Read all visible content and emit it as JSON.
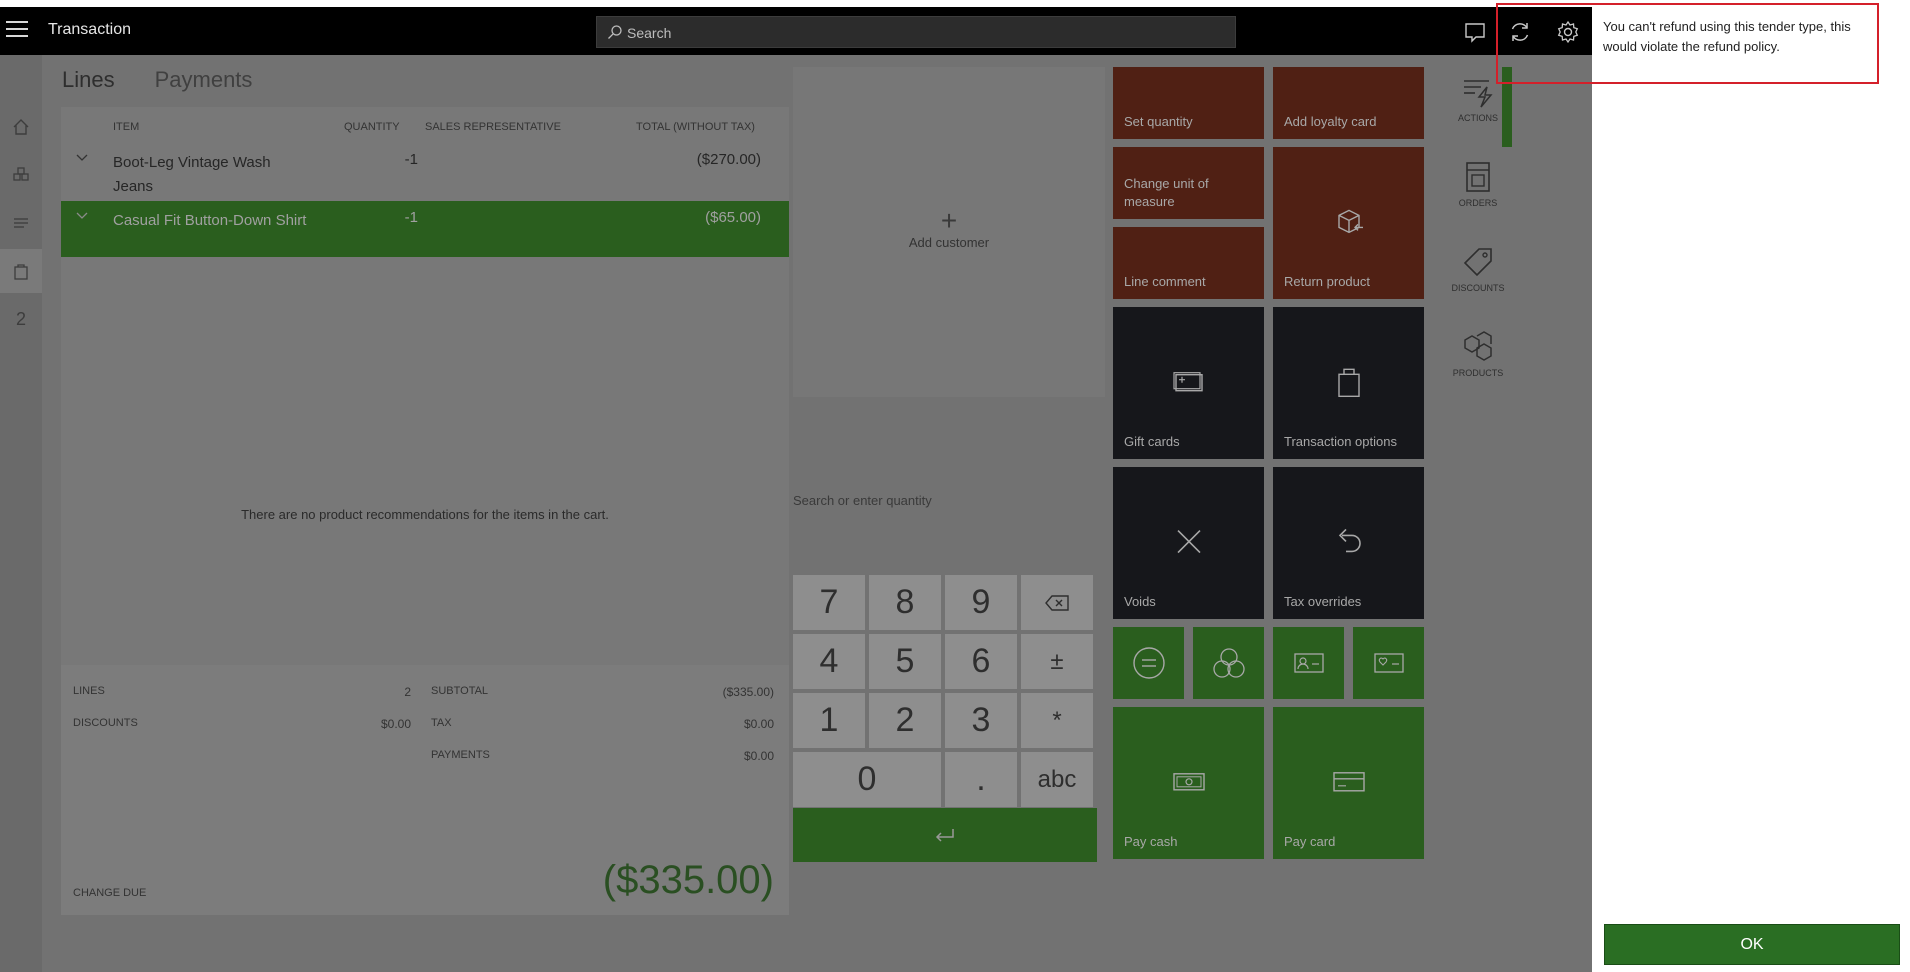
{
  "topbar": {
    "title": "Transaction",
    "search_placeholder": "Search"
  },
  "leftnav": {
    "items": [
      {
        "icon": "home-icon"
      },
      {
        "icon": "products-icon"
      },
      {
        "icon": "list-icon"
      },
      {
        "icon": "bag-icon"
      },
      {
        "label": "2"
      }
    ]
  },
  "tabs": {
    "lines": "Lines",
    "payments": "Payments"
  },
  "lines": {
    "columns": [
      "ITEM",
      "QUANTITY",
      "SALES REPRESENTATIVE",
      "TOTAL (WITHOUT TAX)"
    ],
    "rows": [
      {
        "item": "Boot-Leg Vintage Wash Jeans",
        "quantity": "-1",
        "rep": "",
        "total": "($270.00)"
      },
      {
        "item": "Casual Fit Button-Down Shirt",
        "quantity": "-1",
        "rep": "",
        "total": "($65.00)"
      }
    ],
    "no_recommendations": "There are no product recommendations for the items in the cart."
  },
  "totals": {
    "lines_label": "LINES",
    "lines_value": "2",
    "discounts_label": "DISCOUNTS",
    "discounts_value": "$0.00",
    "subtotal_label": "SUBTOTAL",
    "subtotal_value": "($335.00)",
    "tax_label": "TAX",
    "tax_value": "$0.00",
    "payments_label": "PAYMENTS",
    "payments_value": "$0.00",
    "change_due_label": "CHANGE DUE",
    "change_due_value": "($335.00)"
  },
  "customer": {
    "add_label": "Add customer"
  },
  "numpad": {
    "search_placeholder": "Search or enter quantity",
    "keys": [
      "7",
      "8",
      "9",
      "4",
      "5",
      "6",
      "±",
      "1",
      "2",
      "3",
      "*",
      "0",
      ".",
      "abc"
    ]
  },
  "tiles": {
    "set_quantity": "Set quantity",
    "add_loyalty_card": "Add loyalty card",
    "change_unit_of_measure": "Change unit of measure",
    "return_product": "Return product",
    "line_comment": "Line comment",
    "gift_cards": "Gift cards",
    "transaction_options": "Transaction options",
    "voids": "Voids",
    "tax_overrides": "Tax overrides",
    "pay_cash": "Pay cash",
    "pay_card": "Pay card"
  },
  "actions": {
    "actions": "ACTIONS",
    "orders": "ORDERS",
    "discounts": "DISCOUNTS",
    "products": "PRODUCTS"
  },
  "dialog": {
    "message": "You can't refund using this tender type, this would violate the refund policy.",
    "ok_label": "OK"
  },
  "colors": {
    "accent_green": "#2a6e23",
    "tile_red": "#502014",
    "tile_dark": "#16171b",
    "highlight_red": "#d4202a"
  }
}
